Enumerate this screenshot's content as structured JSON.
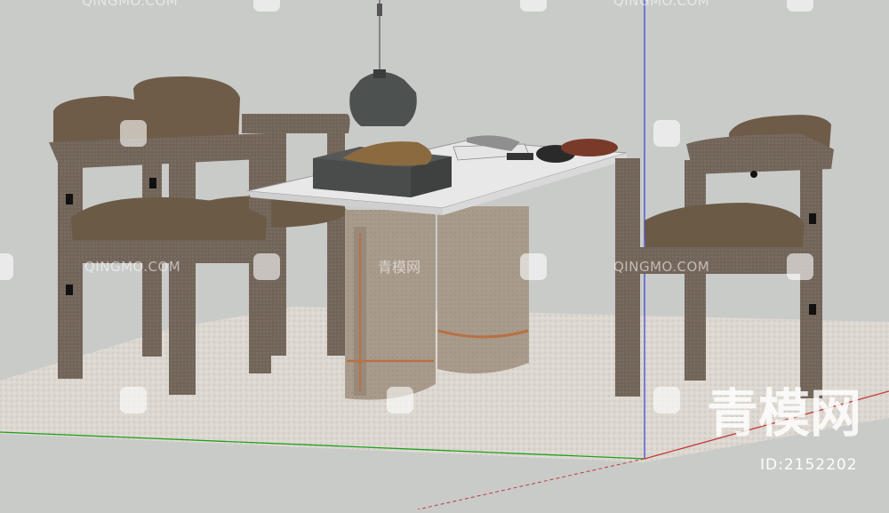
{
  "watermark": {
    "site": "QINGMO.COM",
    "site_cn": "青模网",
    "logo_text": "青模网",
    "id_label": "ID:2152202"
  },
  "colors": {
    "background": "#c9cbc9",
    "axis_green": "#1fa21f",
    "axis_blue": "#3c4bd8",
    "axis_red": "#c33a3a",
    "wood": "#716459",
    "cushion": "#6e5c48",
    "tabletop": "#e8e8e8",
    "pedestal": "#a49686",
    "rug": "#d9d4cd"
  }
}
